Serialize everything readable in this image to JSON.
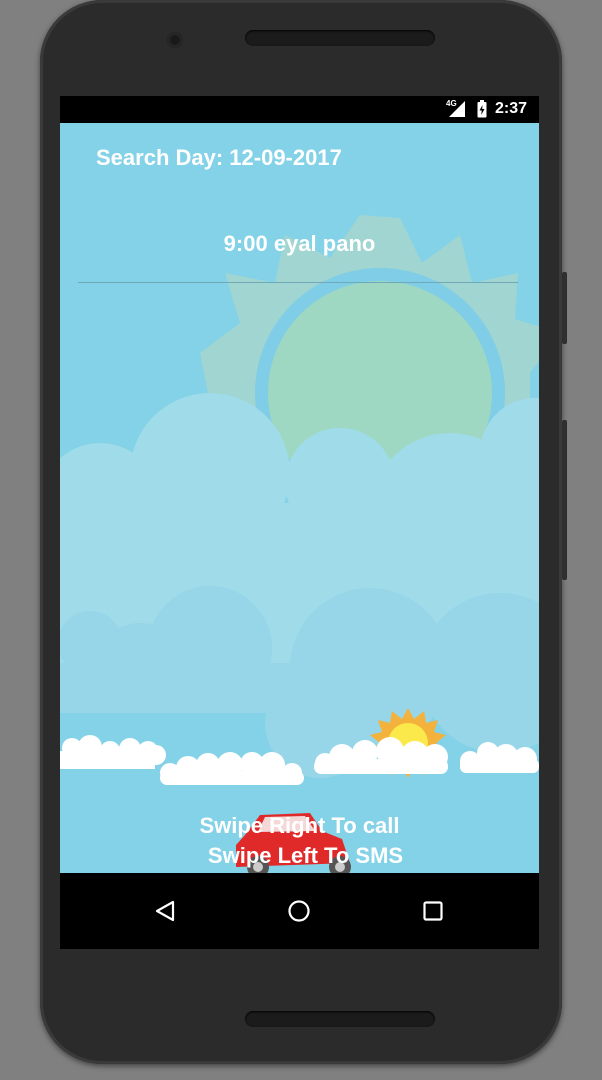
{
  "status_bar": {
    "network": "4G",
    "time": "2:37"
  },
  "app": {
    "search_day": "Search Day: 12-09-2017",
    "appointments": [
      {
        "time": "9:00",
        "name": "eyal pano"
      }
    ],
    "swipe_right_hint": "Swipe Right To call",
    "swipe_left_hint": "Swipe Left To SMS"
  },
  "nav_bar": {
    "back": "back-icon",
    "home": "home-icon",
    "recents": "recents-icon"
  }
}
